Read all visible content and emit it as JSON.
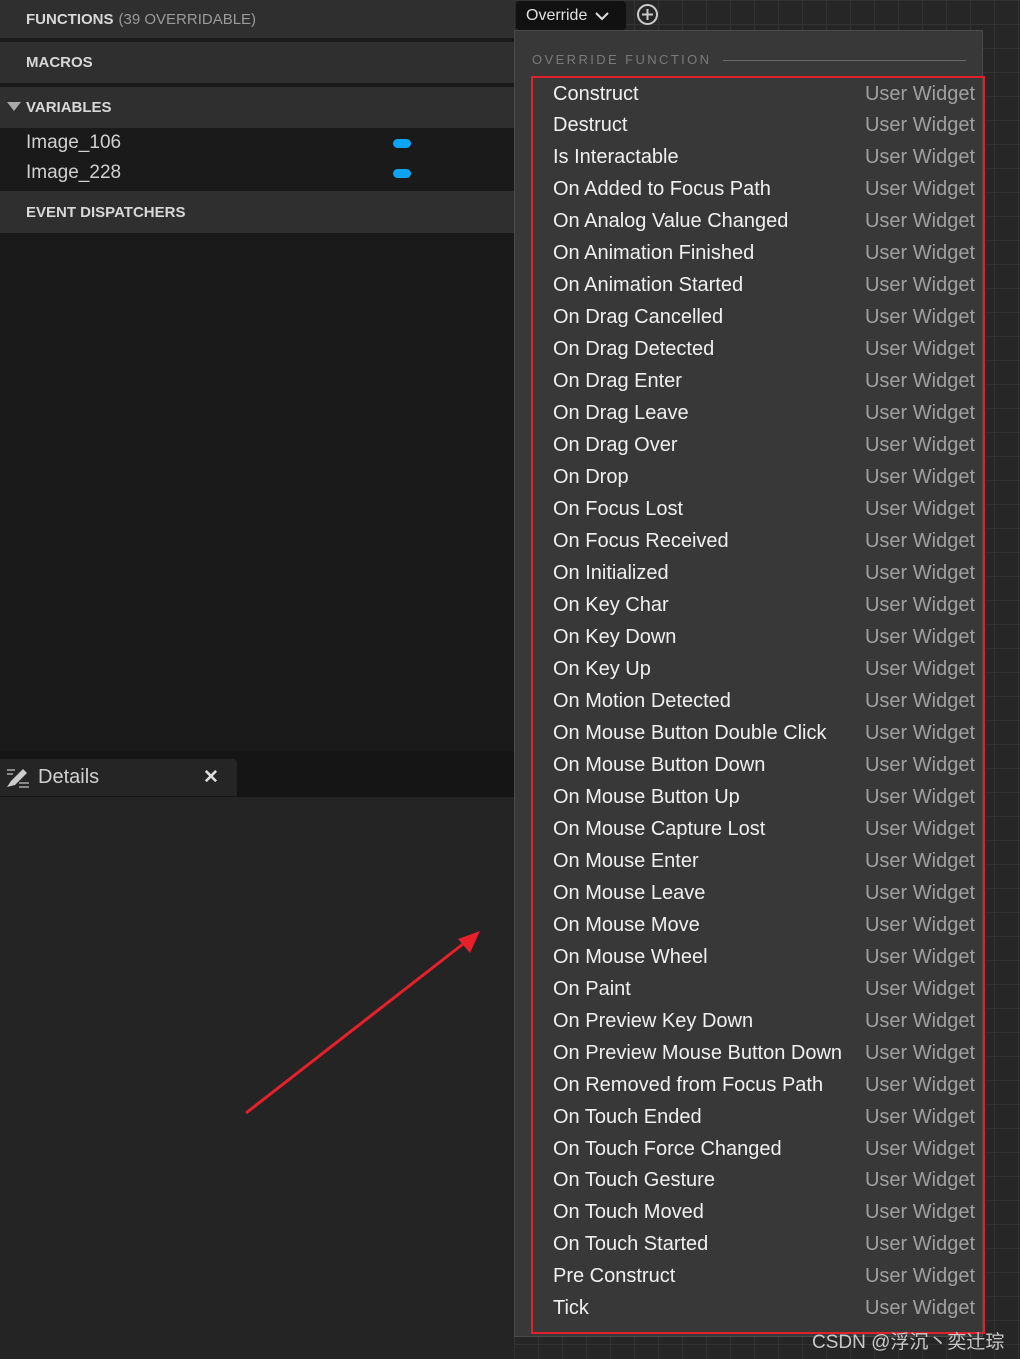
{
  "functions": {
    "label": "FUNCTIONS",
    "count": "(39 OVERRIDABLE)"
  },
  "override_button": "Override",
  "sections": {
    "macros": "MACROS",
    "variables": "VARIABLES",
    "event_dispatchers": "EVENT DISPATCHERS"
  },
  "variables": [
    {
      "name": "Image_106",
      "color": "#0aa5f5"
    },
    {
      "name": "Image_228",
      "color": "#0aa5f5"
    }
  ],
  "details_tab": {
    "label": "Details"
  },
  "menu": {
    "header": "OVERRIDE FUNCTION",
    "highlight_color": "#e0202a",
    "items": [
      "Construct",
      "Destruct",
      "Is Interactable",
      "On Added to Focus Path",
      "On Analog Value Changed",
      "On Animation Finished",
      "On Animation Started",
      "On Drag Cancelled",
      "On Drag Detected",
      "On Drag Enter",
      "On Drag Leave",
      "On Drag Over",
      "On Drop",
      "On Focus Lost",
      "On Focus Received",
      "On Initialized",
      "On Key Char",
      "On Key Down",
      "On Key Up",
      "On Motion Detected",
      "On Mouse Button Double Click",
      "On Mouse Button Down",
      "On Mouse Button Up",
      "On Mouse Capture Lost",
      "On Mouse Enter",
      "On Mouse Leave",
      "On Mouse Move",
      "On Mouse Wheel",
      "On Paint",
      "On Preview Key Down",
      "On Preview Mouse Button Down",
      "On Removed from Focus Path",
      "On Touch Ended",
      "On Touch Force Changed",
      "On Touch Gesture",
      "On Touch Moved",
      "On Touch Started",
      "Pre Construct",
      "Tick"
    ],
    "category": "User Widget"
  },
  "watermark": "CSDN @浮沉丶奕辻琮"
}
